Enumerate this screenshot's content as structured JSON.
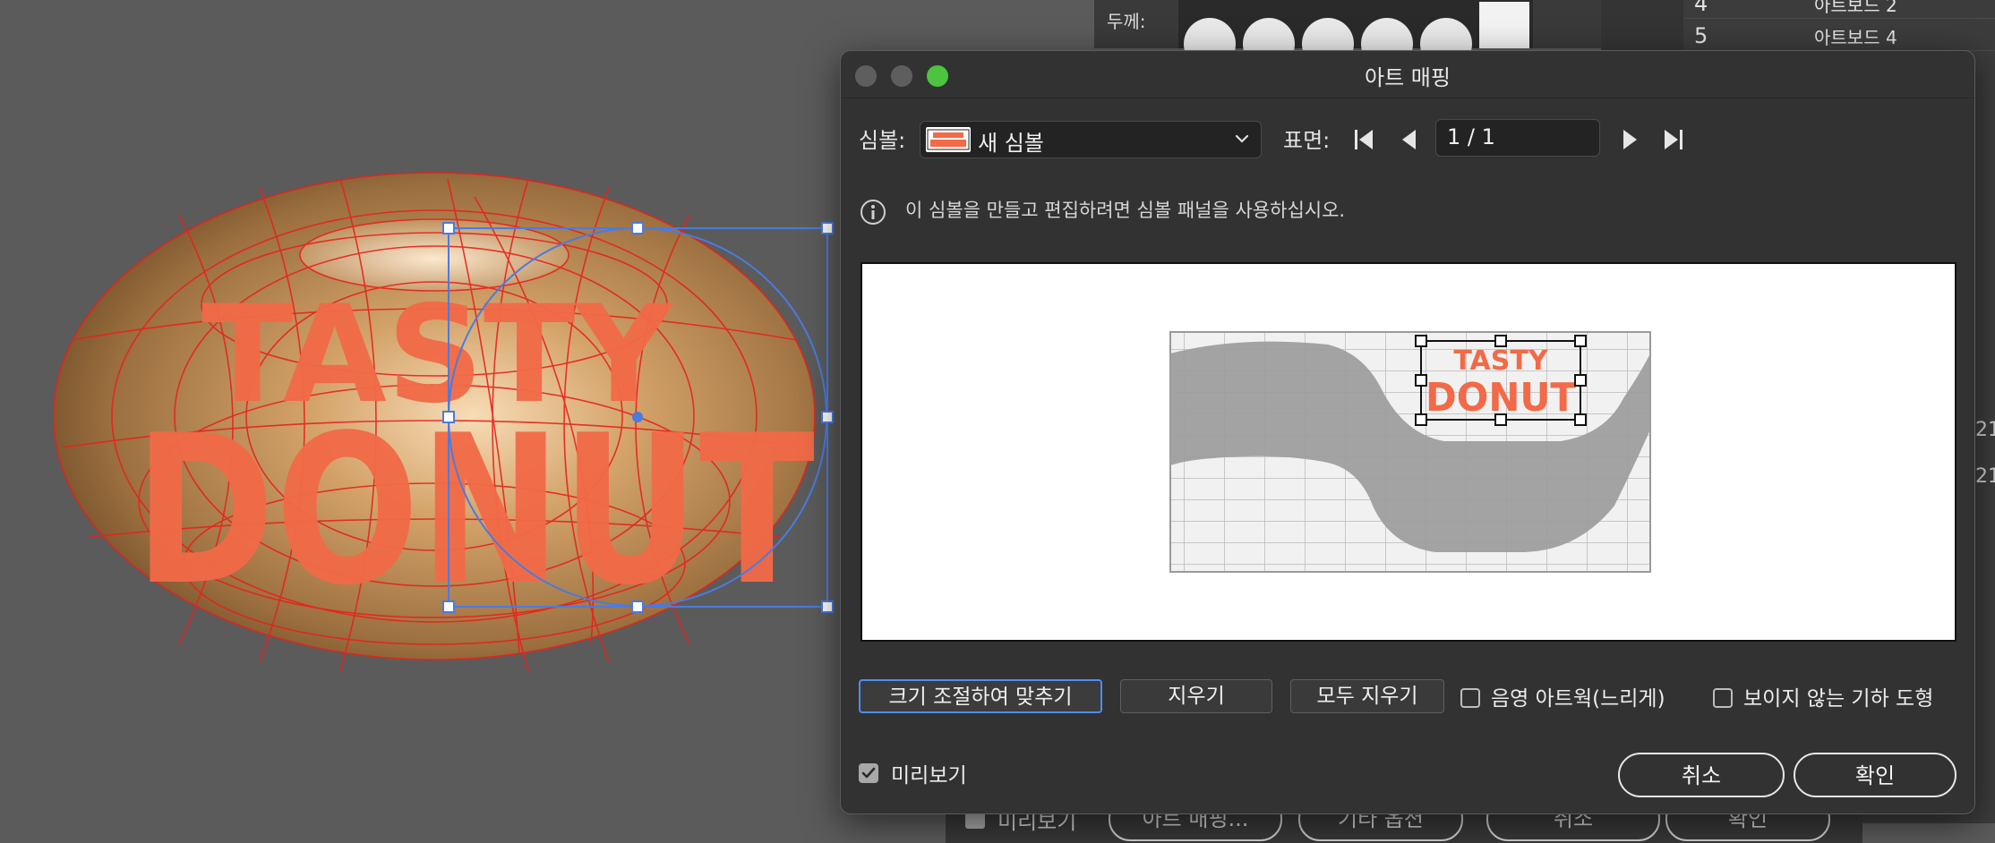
{
  "background_ui": {
    "thickness_label": "두께:",
    "artboards": [
      {
        "num": "4",
        "name": "아트보드 2"
      },
      {
        "num": "5",
        "name": "아트보드 4"
      }
    ],
    "side_numbers": [
      "21",
      "21"
    ],
    "behind_checkbox_label": "미리보기",
    "behind_buttons": [
      "아트 매핑...",
      "기타 옵션",
      "취소",
      "확인"
    ]
  },
  "dialog": {
    "title": "아트 매핑",
    "symbol_label": "심볼:",
    "symbol_value": "새 심볼",
    "surface_label": "표면:",
    "surface_value": "1 / 1",
    "info_text": "이 심볼을 만들고 편집하려면 심볼 패널을 사용하십시오.",
    "buttons": {
      "scale_to_fit": "크기 조절하여 맞추기",
      "clear": "지우기",
      "clear_all": "모두 지우기"
    },
    "checkboxes": {
      "shade_artwork": {
        "label": "음영 아트웍(느리게)",
        "checked": false
      },
      "invisible_geometry": {
        "label": "보이지 않는 기하 도형",
        "checked": false
      },
      "preview": {
        "label": "미리보기",
        "checked": true
      }
    },
    "cancel": "취소",
    "ok": "확인"
  },
  "artwork": {
    "line1": "TASTY",
    "line2": "DONUT"
  },
  "colors": {
    "canvas_bg": "#5b5b5b",
    "dialog_bg": "#323232",
    "accent_blue": "#4a8ef7",
    "donut_text": "#f26a47",
    "wireframe_red": "#e8221a",
    "traffic_close": "#5e5e5e",
    "traffic_min": "#5e5e5e",
    "traffic_max": "#4cc43f"
  },
  "icons": {
    "info": "info-circle-icon",
    "first": "first-page-icon",
    "prev": "previous-icon",
    "next": "next-icon",
    "last": "last-page-icon",
    "dropdown": "chevron-down-icon",
    "check": "checkmark-icon"
  }
}
